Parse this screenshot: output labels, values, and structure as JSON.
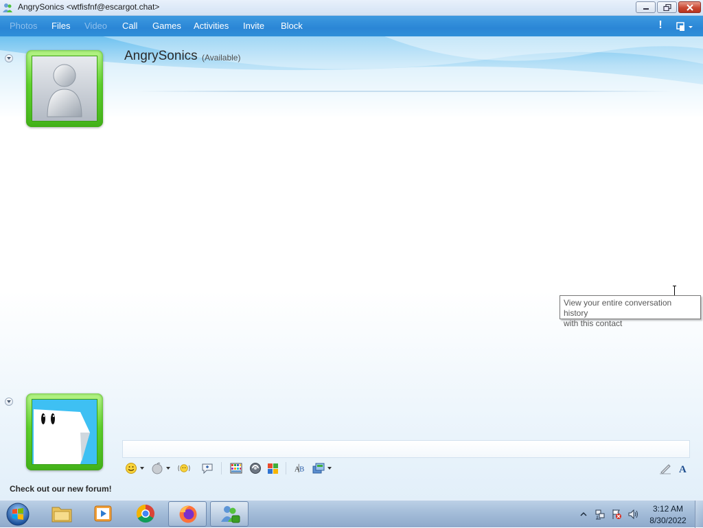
{
  "window": {
    "title": "AngrySonics <wtfisfnf@escargot.chat>"
  },
  "menu": {
    "items": [
      {
        "label": "Photos",
        "enabled": false
      },
      {
        "label": "Files",
        "enabled": true
      },
      {
        "label": "Video",
        "enabled": false
      },
      {
        "label": "Call",
        "enabled": true
      },
      {
        "label": "Games",
        "enabled": true
      },
      {
        "label": "Activities",
        "enabled": true
      },
      {
        "label": "Invite",
        "enabled": true
      },
      {
        "label": "Block",
        "enabled": true
      }
    ],
    "alert_glyph": "!"
  },
  "contact": {
    "name": "AngrySonics",
    "status": "(Available)"
  },
  "tooltip": {
    "line1": "View your entire conversation history",
    "line2": "with this contact"
  },
  "toolbar": {
    "icons": [
      "emoticon-icon",
      "wink-icon",
      "nudge-icon",
      "voice-clip-icon",
      "background-icon",
      "games-icon",
      "activities-icon",
      "font-spell-icon",
      "send-file-icon",
      "handwriting-icon",
      "font-icon"
    ]
  },
  "footer": {
    "ad_text": "Check out our new forum!"
  },
  "taskbar": {
    "clock_time": "3:12 AM",
    "clock_date": "8/30/2022"
  },
  "colors": {
    "menu_bar": "#2b86d6",
    "avatar_frame_green": "#5fd12d",
    "self_avatar_bg": "#3ec0f3"
  }
}
